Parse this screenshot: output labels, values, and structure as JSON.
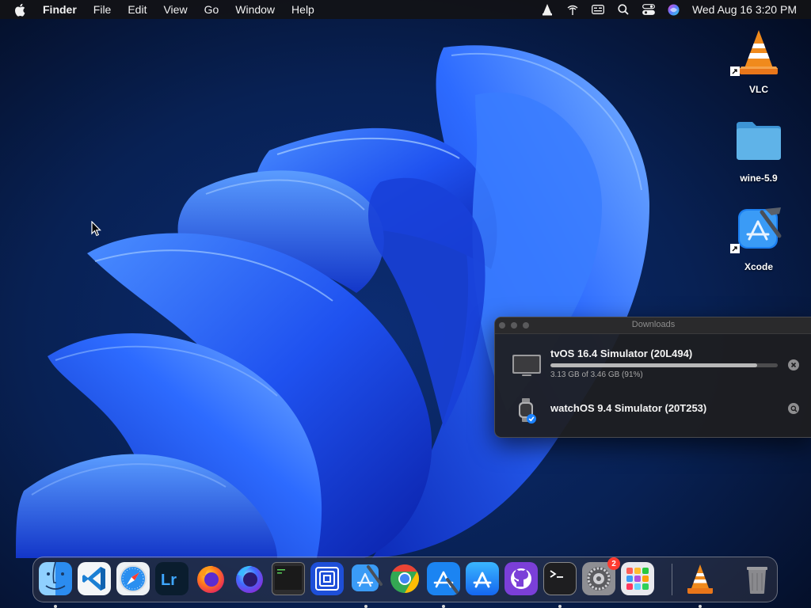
{
  "menubar": {
    "app_name": "Finder",
    "items": [
      "File",
      "Edit",
      "View",
      "Go",
      "Window",
      "Help"
    ],
    "status_icons": [
      "vlc-icon",
      "airdrop-icon",
      "keyboard-input-icon",
      "search-icon",
      "control-center-icon",
      "siri-icon"
    ],
    "clock": "Wed Aug 16  3:20 PM"
  },
  "desktop_icons": [
    {
      "label": "VLC",
      "icon": "vlc-icon",
      "alias": true
    },
    {
      "label": "wine-5.9",
      "icon": "folder-icon",
      "alias": false
    },
    {
      "label": "Xcode",
      "icon": "xcode-icon",
      "alias": true
    }
  ],
  "downloads": {
    "title": "Downloads",
    "items": [
      {
        "name": "tvOS 16.4 Simulator (20L494)",
        "status": "3.13 GB of 3.46 GB (91%)",
        "progress": 0.91,
        "icon": "tv-display-icon",
        "action_icon": "cancel-icon"
      },
      {
        "name": "watchOS 9.4 Simulator (20T253)",
        "status": "",
        "progress": 1.0,
        "icon": "watch-icon",
        "action_icon": "reveal-magnifier-icon"
      }
    ]
  },
  "dock": {
    "badge_settings": "2",
    "apps": [
      {
        "name": "Finder",
        "icon": "finder-icon",
        "running": true
      },
      {
        "name": "Visual Studio Code",
        "icon": "vscode-icon",
        "running": false
      },
      {
        "name": "Safari",
        "icon": "safari-icon",
        "running": false
      },
      {
        "name": "Lightroom",
        "icon": "lightroom-icon",
        "running": false
      },
      {
        "name": "Firefox",
        "icon": "firefox-icon",
        "running": false
      },
      {
        "name": "Firefox Developer",
        "icon": "firefox-dev-icon",
        "running": false
      },
      {
        "name": "Console",
        "icon": "console-icon",
        "running": false
      },
      {
        "name": "Remote Desktop",
        "icon": "remote-icon",
        "running": false
      },
      {
        "name": "Xcode",
        "icon": "xcode-icon",
        "running": true
      },
      {
        "name": "Chrome",
        "icon": "chrome-icon",
        "running": false
      },
      {
        "name": "Instruments",
        "icon": "appstore-tools-icon",
        "running": true
      },
      {
        "name": "App Store",
        "icon": "appstore-icon",
        "running": false
      },
      {
        "name": "GitHub Desktop",
        "icon": "github-icon",
        "running": false
      },
      {
        "name": "Terminal",
        "icon": "terminal-icon",
        "running": true
      },
      {
        "name": "System Settings",
        "icon": "settings-icon",
        "running": false
      },
      {
        "name": "Launchpad",
        "icon": "launchpad-icon",
        "running": false
      },
      {
        "name": "VLC",
        "icon": "vlc-icon",
        "running": true
      },
      {
        "name": "Trash",
        "icon": "trash-icon",
        "running": false
      }
    ]
  },
  "colors": {
    "wallpaper_dark": "#061634",
    "wallpaper_blue": "#1f52f0",
    "vlc_orange": "#f08a1c",
    "folder_blue": "#5fb3e8",
    "badge_red": "#ff3b30"
  }
}
